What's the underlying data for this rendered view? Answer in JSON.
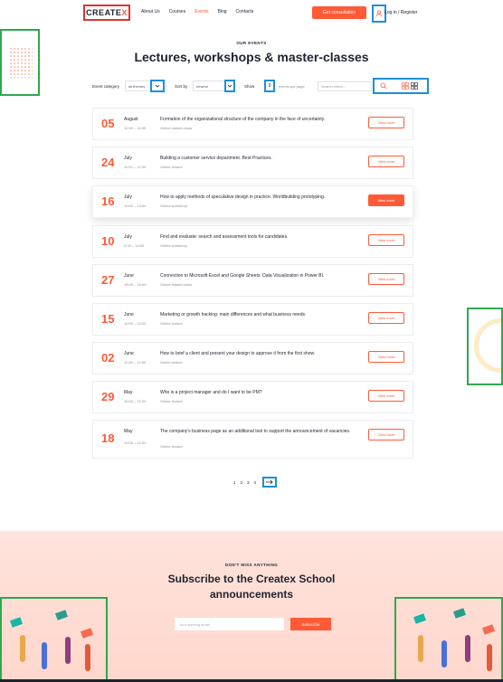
{
  "header": {
    "logo_main": "CREATE",
    "logo_x": "X",
    "nav": [
      "About Us",
      "Courses",
      "Events",
      "Blog",
      "Contacts"
    ],
    "active_nav": "Events",
    "cta": "Get consultation",
    "login": "Log in / Register",
    "user_icon": "user-icon"
  },
  "intro": {
    "eyebrow": "OUR EVENTS",
    "title": "Lectures, workshops & master-classes"
  },
  "filters": {
    "category_label": "Event category",
    "category_value": "all themes",
    "sort_label": "Sort by",
    "sort_value": "newest",
    "show_label": "Show",
    "show_value": "9",
    "per_page": "events per page",
    "search_placeholder": "Search event...",
    "search_icon": "search-icon",
    "grid_view_icon": "grid-view-icon",
    "list_view_icon": "list-view-icon"
  },
  "events": [
    {
      "day": "05",
      "month": "August",
      "time": "11:00 – 14:00",
      "title": "Formation of the organizational structure of the company in the face of uncertainty.",
      "type": "Online master-class",
      "button": "View more"
    },
    {
      "day": "24",
      "month": "July",
      "time": "11:00 – 12:30",
      "title": "Building a customer service department. Best Practices.",
      "type": "Online lecture",
      "button": "View more"
    },
    {
      "day": "16",
      "month": "July",
      "time": "10:00 – 13:00",
      "title": "How to apply methods of speculative design in practice. Worldbuilding prototyping.",
      "type": "Online workshop",
      "button": "View more"
    },
    {
      "day": "10",
      "month": "July",
      "time": "9:00 – 14:00",
      "title": "Find and evaluate: search and assessment tools for candidates.",
      "type": "Online workshop",
      "button": "View more"
    },
    {
      "day": "27",
      "month": "June",
      "time": "15:00 – 19:00",
      "title": "Connection to Microsoft Excel and Google Sheets. Data Visualization in Power BI.",
      "type": "Online master-class",
      "button": "View more"
    },
    {
      "day": "15",
      "month": "June",
      "time": "10:00 – 12:00",
      "title": "Marketing or growth hacking: main differences and what business needs.",
      "type": "Online lecture",
      "button": "View more"
    },
    {
      "day": "02",
      "month": "June",
      "time": "11:00 – 12:00",
      "title": "How to brief a client and present your design to approve it from the first show.",
      "type": "Online lecture",
      "button": "View more"
    },
    {
      "day": "29",
      "month": "May",
      "time": "10:00 – 12:00",
      "title": "Who is a project manager and do I want to be PM?",
      "type": "Online lecture",
      "button": "View more"
    },
    {
      "day": "18",
      "month": "May",
      "time": "10:00 – 12:00",
      "title": "The company's business page as an additional tool to support the announcement of vacancies.",
      "type": "Online lecture",
      "button": "View more"
    }
  ],
  "pagination": {
    "pages": [
      "1",
      "2",
      "3",
      "4"
    ],
    "next_icon": "arrow-right-icon"
  },
  "subscribe": {
    "eyebrow": "DON'T MISS ANYTHING",
    "title": "Subscribe to the Createx School announcements",
    "placeholder": "Your working email",
    "button": "Subscribe"
  },
  "colors": {
    "accent": "#ff5a36",
    "dark": "#1e2330",
    "highlight_blue": "#1e8fd6",
    "highlight_green": "#2fa84f",
    "highlight_red": "#d33333"
  }
}
